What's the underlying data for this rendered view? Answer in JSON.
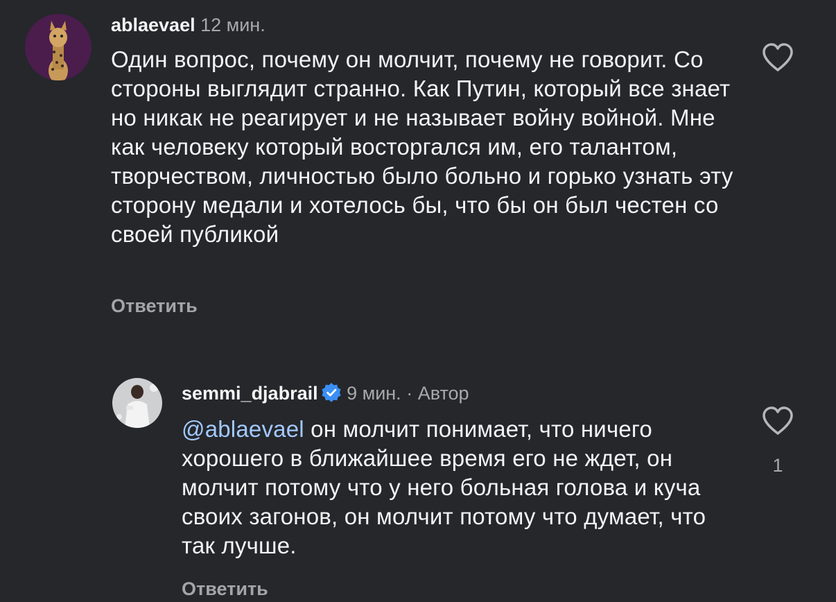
{
  "comments": [
    {
      "username": "ablaevael",
      "time": "12 мин.",
      "text": "Один вопрос, почему он молчит, почему не говорит. Со стороны выглядит странно. Как Путин, который все знает но никак не реагирует и не называет войну войной. Мне как человеку который восторгался им, его талантом, творчеством, личностью было больно и горько узнать эту сторону медали и хотелось бы, что бы он был честен со своей публикой",
      "reply_label": "Ответить"
    },
    {
      "username": "semmi_djabrail",
      "verified": true,
      "time": "9 мин.",
      "separator": "·",
      "author_badge": "Автор",
      "mention": "@ablaevael",
      "text": " он молчит понимает, что ничего хорошего в ближайшее время его не ждет, он молчит потому что у него больная голова и куча своих загонов, он молчит потому что думает, что так лучше.",
      "reply_label": "Ответить",
      "like_count": "1"
    }
  ],
  "colors": {
    "background": "#25272b",
    "text": "#f4f4f5",
    "muted": "#a8a9ad",
    "mention": "#a3c9ff",
    "verified": "#3b8ff5",
    "avatar1_bg": "#4a1d4d"
  },
  "icons": {
    "like": "heart-outline-icon",
    "verified": "verified-badge-icon"
  }
}
